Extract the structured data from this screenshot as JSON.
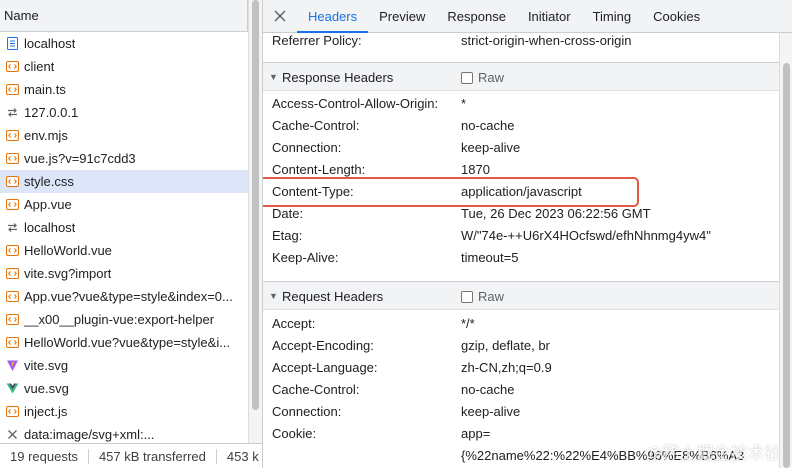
{
  "request_list": {
    "header": "Name",
    "items": [
      {
        "label": "localhost",
        "icon": "document-icon",
        "selected": false
      },
      {
        "label": "client",
        "icon": "script-icon",
        "selected": false
      },
      {
        "label": "main.ts",
        "icon": "script-icon",
        "selected": false
      },
      {
        "label": "127.0.0.1",
        "icon": "websocket-icon",
        "selected": false
      },
      {
        "label": "env.mjs",
        "icon": "script-icon",
        "selected": false
      },
      {
        "label": "vue.js?v=91c7cdd3",
        "icon": "script-icon",
        "selected": false
      },
      {
        "label": "style.css",
        "icon": "script-icon",
        "selected": true
      },
      {
        "label": "App.vue",
        "icon": "script-icon",
        "selected": false
      },
      {
        "label": "localhost",
        "icon": "websocket-icon",
        "selected": false
      },
      {
        "label": "HelloWorld.vue",
        "icon": "script-icon",
        "selected": false
      },
      {
        "label": "vite.svg?import",
        "icon": "script-icon",
        "selected": false
      },
      {
        "label": "App.vue?vue&type=style&index=0...",
        "icon": "script-icon",
        "selected": false
      },
      {
        "label": "__x00__plugin-vue:export-helper",
        "icon": "script-icon",
        "selected": false
      },
      {
        "label": "HelloWorld.vue?vue&type=style&i...",
        "icon": "script-icon",
        "selected": false
      },
      {
        "label": "vite.svg",
        "icon": "vite-logo-icon",
        "selected": false
      },
      {
        "label": "vue.svg",
        "icon": "vue-logo-icon",
        "selected": false
      },
      {
        "label": "inject.js",
        "icon": "script-icon",
        "selected": false
      },
      {
        "label": "data:image/svg+xml:...",
        "icon": "cancelled-icon",
        "selected": false
      }
    ]
  },
  "status_bar": {
    "requests": "19 requests",
    "transferred": "457 kB transferred",
    "resources": "453 k"
  },
  "tabs": {
    "items": [
      "Headers",
      "Preview",
      "Response",
      "Initiator",
      "Timing",
      "Cookies"
    ],
    "active": "Headers"
  },
  "general": {
    "referrer_policy": {
      "key": "Referrer Policy:",
      "value": "strict-origin-when-cross-origin"
    }
  },
  "response_headers": {
    "title": "Response Headers",
    "raw_label": "Raw",
    "rows": [
      {
        "key": "Access-Control-Allow-Origin:",
        "value": "*"
      },
      {
        "key": "Cache-Control:",
        "value": "no-cache"
      },
      {
        "key": "Connection:",
        "value": "keep-alive"
      },
      {
        "key": "Content-Length:",
        "value": "1870"
      },
      {
        "key": "Content-Type:",
        "value": "application/javascript"
      },
      {
        "key": "Date:",
        "value": "Tue, 26 Dec 2023 06:22:56 GMT"
      },
      {
        "key": "Etag:",
        "value": "W/\"74e-++U6rX4HOcfswd/efhNhnmg4yw4\""
      },
      {
        "key": "Keep-Alive:",
        "value": "timeout=5"
      }
    ]
  },
  "request_headers": {
    "title": "Request Headers",
    "raw_label": "Raw",
    "rows": [
      {
        "key": "Accept:",
        "value": "*/*"
      },
      {
        "key": "Accept-Encoding:",
        "value": "gzip, deflate, br"
      },
      {
        "key": "Accept-Language:",
        "value": "zh-CN,zh;q=0.9"
      },
      {
        "key": "Cache-Control:",
        "value": "no-cache"
      },
      {
        "key": "Connection:",
        "value": "keep-alive"
      },
      {
        "key": "Cookie:",
        "value": "app="
      },
      {
        "key": "",
        "value": "{%22name%22:%22%E4%BB%96%E8%B6%A3"
      }
    ]
  },
  "watermark": "@稀土掘金技术社区",
  "colors": {
    "accent": "#1a73e8",
    "highlight_border": "#e05a47",
    "selected_row": "#dde6f8"
  }
}
